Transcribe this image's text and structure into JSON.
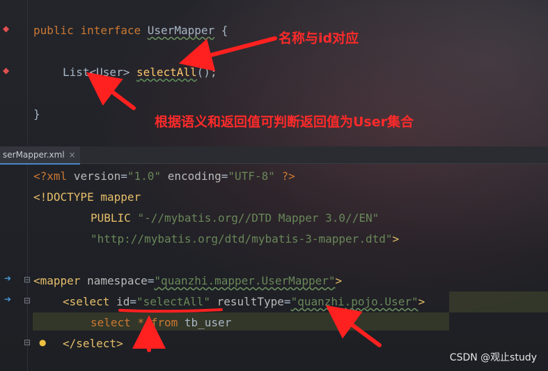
{
  "editor_top": {
    "line1": {
      "kw1": "public",
      "kw2": "interface",
      "name": "UserMapper",
      "brace": "{"
    },
    "line2": {
      "type": "List<User>",
      "method": "selectAll",
      "rest": "();"
    },
    "line3": {
      "brace": "}"
    }
  },
  "tab": {
    "label": "serMapper.xml",
    "close": "×"
  },
  "xml": {
    "decl": {
      "open": "<?xml",
      "attr1": "version",
      "val1": "\"1.0\"",
      "attr2": "encoding",
      "val2": "\"UTF-8\"",
      "close": "?>"
    },
    "doctype": {
      "text": "<!DOCTYPE mapper"
    },
    "public": {
      "kw": "PUBLIC",
      "val": "\"-//mybatis.org//DTD Mapper 3.0//EN\""
    },
    "system": {
      "val": "\"http://mybatis.org/dtd/mybatis-3-mapper.dtd\"",
      "close": ">"
    },
    "mapper": {
      "open": "<mapper",
      "attr": "namespace",
      "eq": "=",
      "val": "\"quanzhi.mapper.UserMapper\"",
      "close": ">"
    },
    "select": {
      "open": "<select",
      "attr1": "id",
      "eq1": "=",
      "val1": "\"selectAll\"",
      "attr2": "resultType",
      "eq2": "=",
      "val2": "\"quanzhi.pojo.User\"",
      "close": ">"
    },
    "sql": {
      "kw1": "select",
      "star": "*",
      "kw2": "from",
      "table": "tb_user"
    },
    "end": {
      "text": "</select>"
    }
  },
  "annotations": {
    "a1": "名称与id对应",
    "a2": "根据语义和返回值可判断返回值为User集合"
  },
  "icons": {
    "bulb": "lightbulb-icon",
    "gutter": "mapper-jump-icon"
  },
  "colors": {
    "keyword": "#cc7832",
    "string": "#6a8759",
    "tag": "#e8bf6a",
    "method": "#ffc66d",
    "annotation": "#ff2a2a"
  },
  "watermark": "CSDN @观止study"
}
